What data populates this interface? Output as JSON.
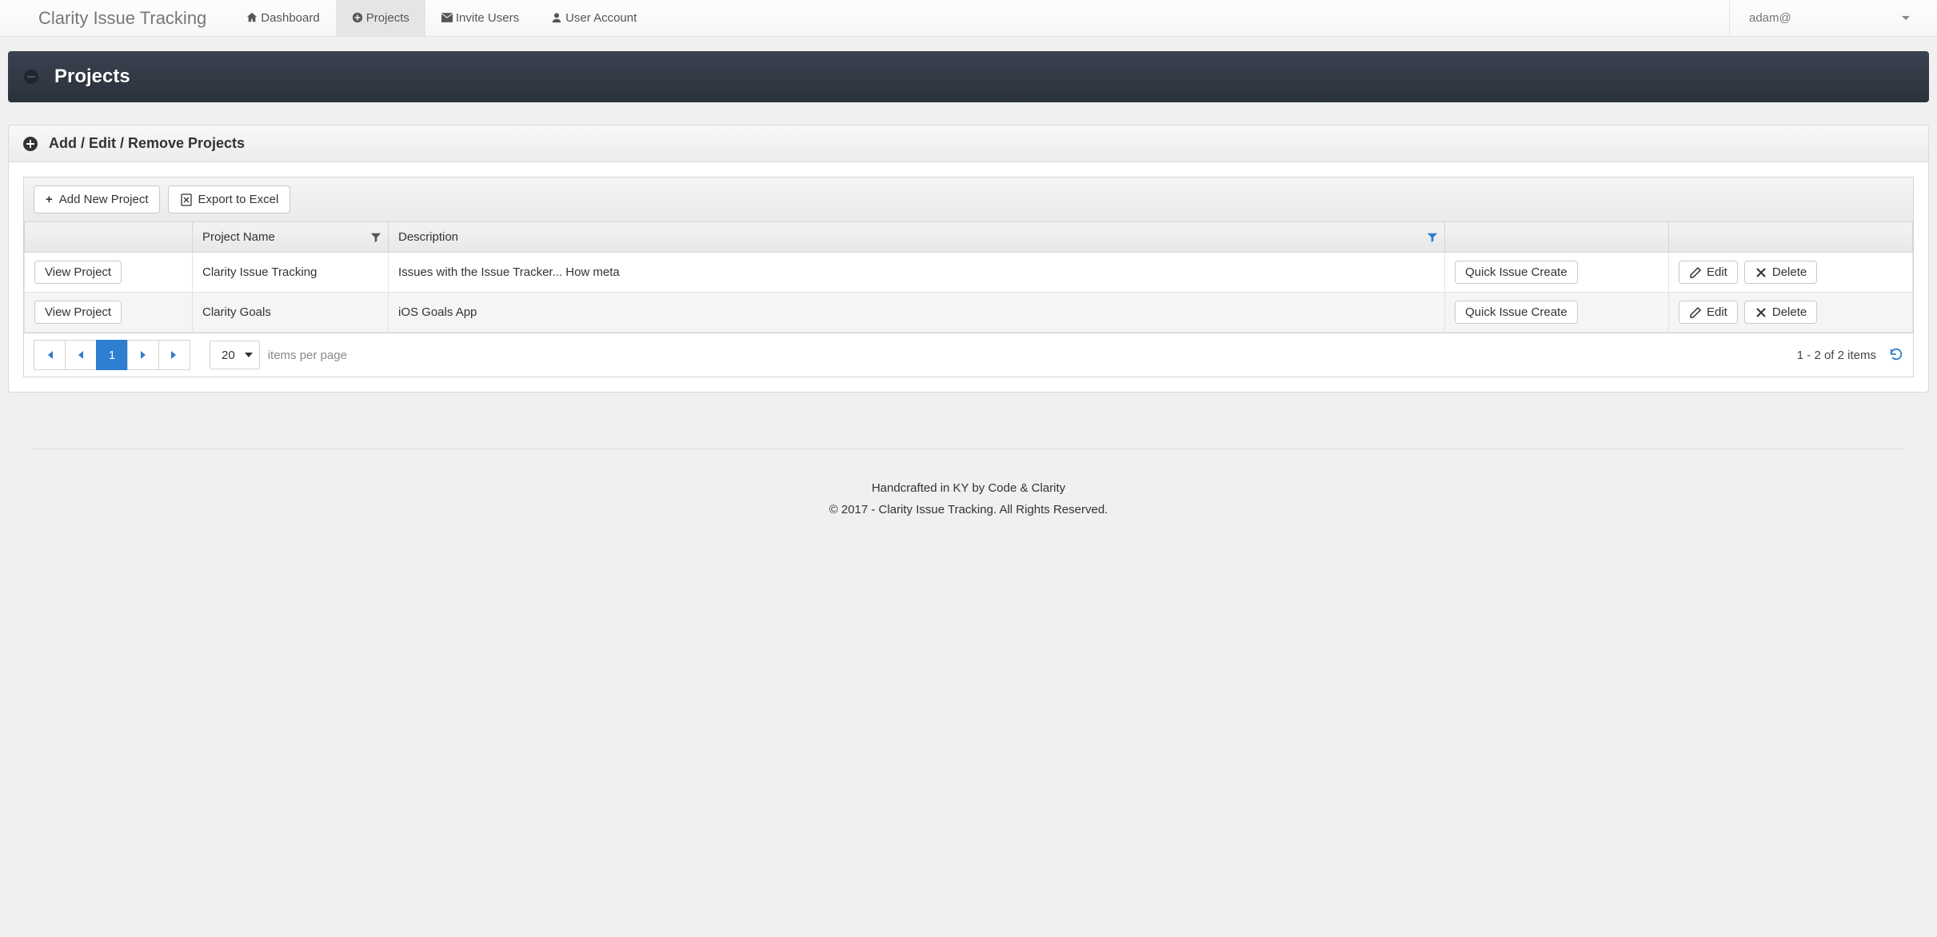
{
  "brand": "Clarity Issue Tracking",
  "nav": {
    "dashboard": "Dashboard",
    "projects": "Projects",
    "invite": "Invite Users",
    "account": "User Account"
  },
  "user": {
    "email": "adam@"
  },
  "page": {
    "title": "Projects",
    "panel_title": "Add / Edit / Remove Projects"
  },
  "toolbar": {
    "add": "Add New Project",
    "export": "Export to Excel"
  },
  "grid": {
    "headers": {
      "name": "Project Name",
      "desc": "Description"
    },
    "row_buttons": {
      "view": "View Project",
      "quick": "Quick Issue Create",
      "edit": "Edit",
      "delete": "Delete"
    },
    "rows": [
      {
        "name": "Clarity Issue Tracking",
        "desc": "Issues with the Issue Tracker... How meta"
      },
      {
        "name": "Clarity Goals",
        "desc": "iOS Goals App"
      }
    ]
  },
  "pager": {
    "current": "1",
    "size": "20",
    "label": "items per page",
    "summary": "1 - 2 of 2 items"
  },
  "footer": {
    "line1": "Handcrafted in KY by Code & Clarity",
    "line2": "© 2017 - Clarity Issue Tracking. All Rights Reserved."
  }
}
